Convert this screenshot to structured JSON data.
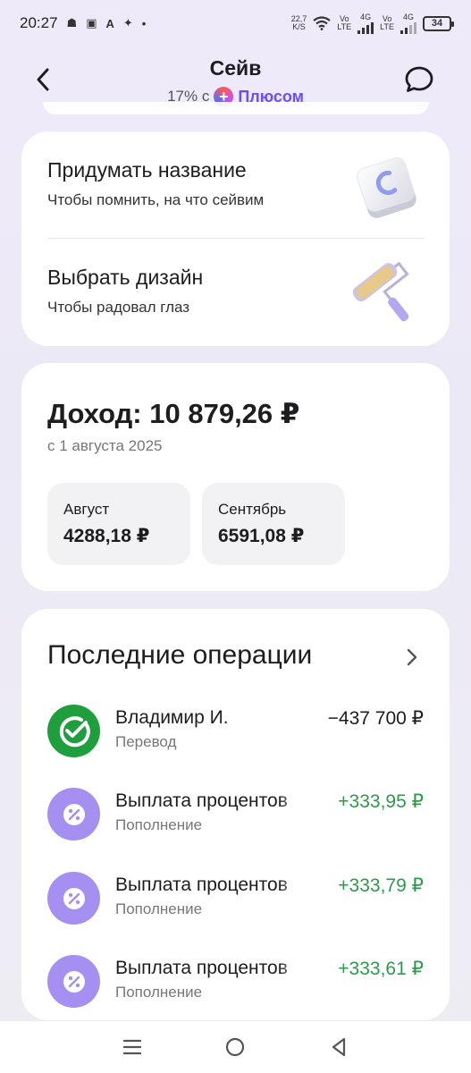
{
  "status_bar": {
    "time": "20:27",
    "speed_value": "22,7",
    "speed_unit": "K/S",
    "net1_top": "Vo",
    "net1_bottom": "LTE",
    "net1_gen": "4G",
    "net2_top": "Vo",
    "net2_bottom": "LTE",
    "net2_gen": "4G",
    "battery": "34",
    "icons": [
      "dots-icon",
      "wifi-icon",
      "signal-icon",
      "battery-icon"
    ]
  },
  "header": {
    "title": "Сейв",
    "subtitle_prefix": "17% с",
    "subtitle_brand": "Плюсом",
    "back_icon": "chevron-left-icon",
    "chat_icon": "chat-bubble-icon"
  },
  "setup": {
    "name": {
      "title": "Придумать название",
      "subtitle": "Чтобы помнить, на что сейвим",
      "icon": "keyboard-key-icon"
    },
    "design": {
      "title": "Выбрать дизайн",
      "subtitle": "Чтобы радовал глаз",
      "icon": "paint-roller-icon"
    }
  },
  "income": {
    "label": "Доход:",
    "amount": "10 879,26 ₽",
    "since": "с 1 августа 2025",
    "months": [
      {
        "name": "Август",
        "value": "4288,18 ₽"
      },
      {
        "name": "Сентябрь",
        "value": "6591,08 ₽"
      }
    ]
  },
  "operations": {
    "title": "Последние операции",
    "items": [
      {
        "name": "Владимир И.",
        "type": "Перевод",
        "amount": "−437 700 ₽",
        "icon": "sber-check-icon",
        "sign": "minus"
      },
      {
        "name": "Выплата процентов",
        "type": "Пополнение",
        "amount": "+333,95 ₽",
        "icon": "percent-icon",
        "sign": "plus"
      },
      {
        "name": "Выплата процентов",
        "type": "Пополнение",
        "amount": "+333,79 ₽",
        "icon": "percent-icon",
        "sign": "plus"
      },
      {
        "name": "Выплата процентов",
        "type": "Пополнение",
        "amount": "+333,61 ₽",
        "icon": "percent-icon",
        "sign": "plus"
      }
    ]
  },
  "nav": {
    "icons": [
      "menu-icon",
      "home-icon",
      "back-triangle-icon"
    ]
  },
  "colors": {
    "accent": "#6a4dff",
    "positive": "#2c9a4a",
    "sber_green": "#1f9e3d",
    "percent_purple": "#a58ff0"
  }
}
